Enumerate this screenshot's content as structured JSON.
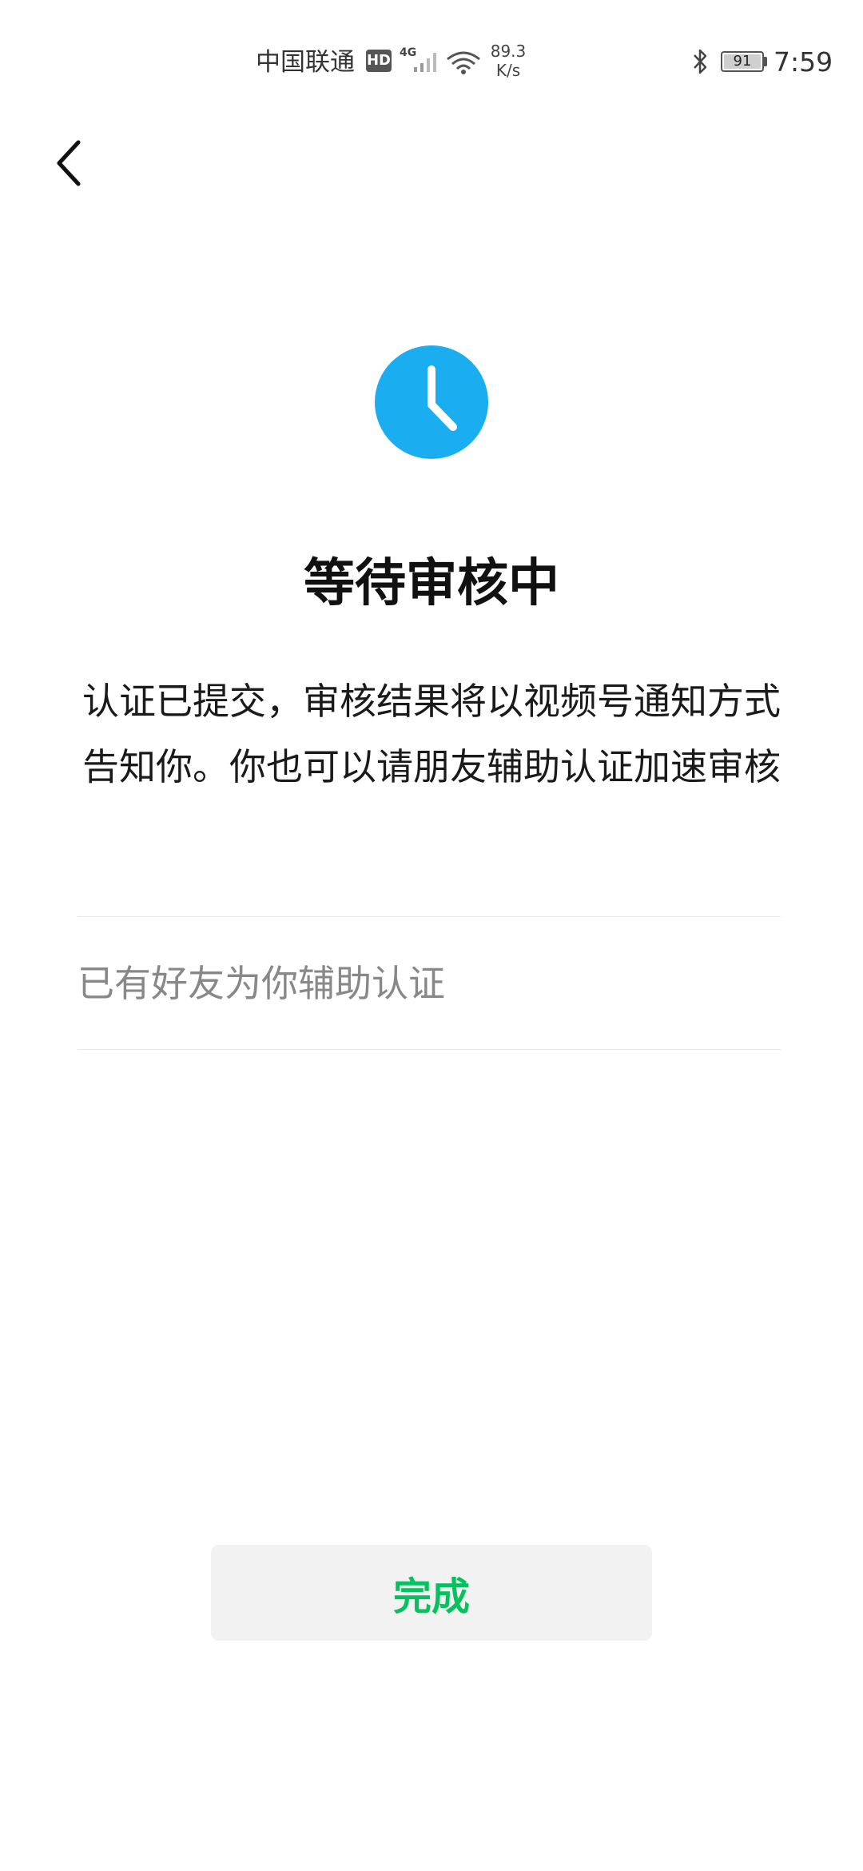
{
  "status_bar": {
    "carrier": "中国联通",
    "hd_label": "HD",
    "network_type": "4G",
    "speed_value": "89.3",
    "speed_unit": "K/s",
    "battery_level": "91",
    "time": "7:59"
  },
  "icons": {
    "back": "chevron-left-icon",
    "pending": "clock-icon",
    "bluetooth": "bluetooth-icon",
    "wifi": "wifi-icon",
    "signal": "signal-icon"
  },
  "colors": {
    "accent_blue": "#1AAEF0",
    "accent_green": "#07C160",
    "button_bg": "#F2F2F2"
  },
  "main": {
    "title": "等待审核中",
    "description": "认证已提交，审核结果将以视频号通知方式告知你。你也可以请朋友辅助认证加速审核",
    "helper_label": "已有好友为你辅助认证"
  },
  "footer": {
    "done_label": "完成"
  }
}
